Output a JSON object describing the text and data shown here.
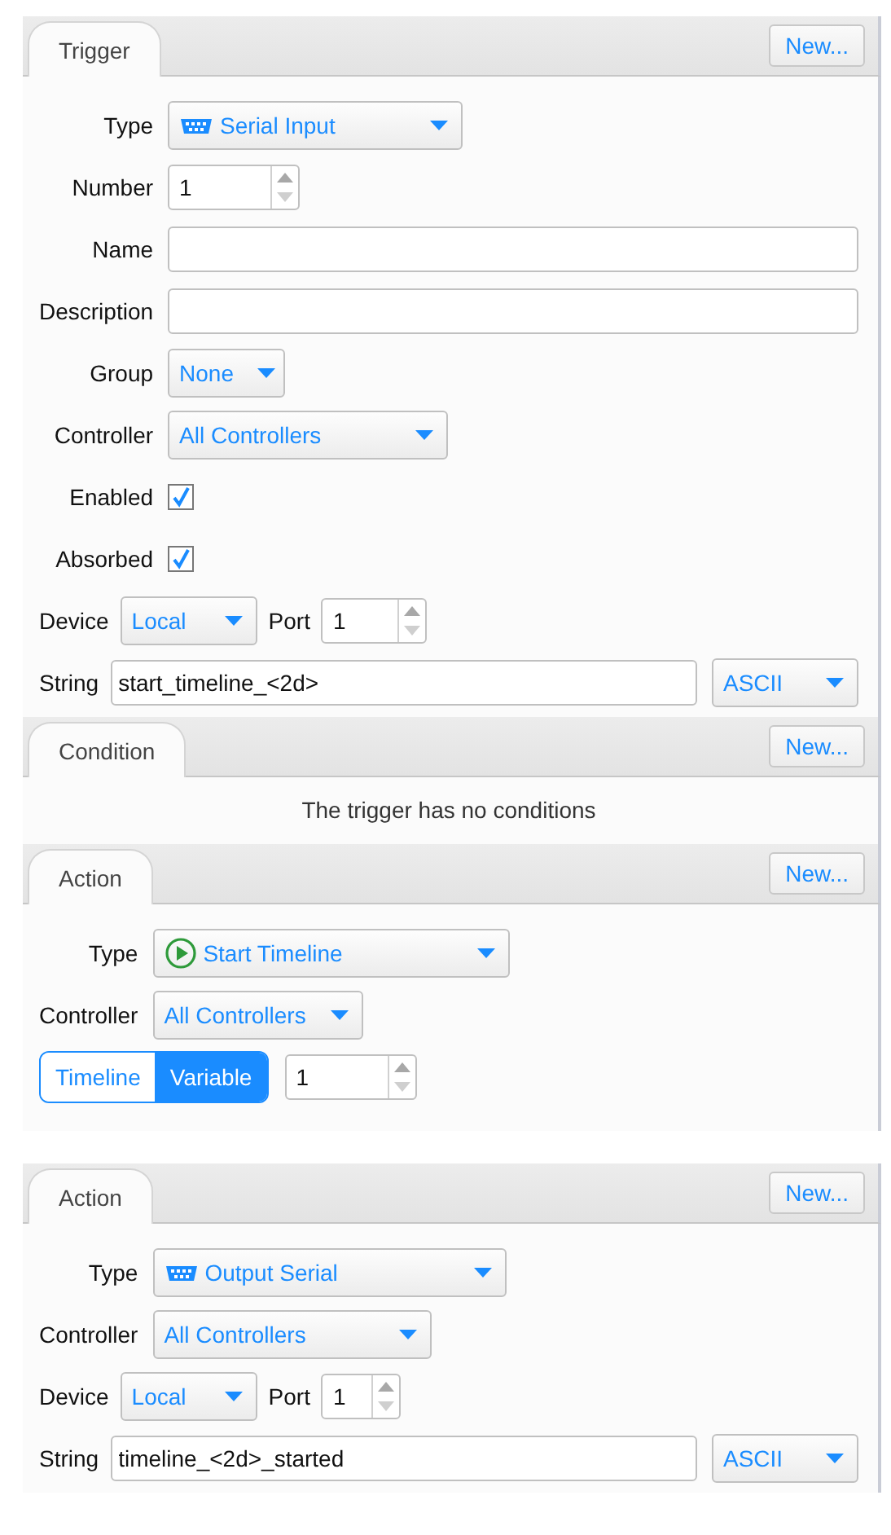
{
  "sections": [
    {
      "tab": "Trigger",
      "new_button": "New...",
      "rows": [
        {
          "kind": "dropdown",
          "label": "Type",
          "value": "Serial Input"
        },
        {
          "kind": "spinner",
          "label": "Number",
          "value": "1"
        },
        {
          "kind": "text",
          "label": "Name"
        },
        {
          "kind": "text",
          "label": "Description"
        },
        {
          "kind": "dropdown",
          "label": "Group",
          "value": "None"
        },
        {
          "kind": "dropdown",
          "label": "Controller",
          "value": "All Controllers"
        },
        {
          "kind": "checkbox",
          "label": "Enabled",
          "checked": true
        },
        {
          "kind": "checkbox",
          "label": "Absorbed",
          "checked": true
        },
        {
          "kind": "device",
          "label": "Device",
          "value": "Local",
          "port_label": "Port",
          "port": "1"
        },
        {
          "kind": "string",
          "label": "String",
          "value": "start_timeline_<2d>",
          "encoding": "ASCII"
        }
      ]
    },
    {
      "tab": "Condition",
      "new_button": "New...",
      "rows": [
        {
          "kind": "message",
          "text": "The trigger has no conditions"
        }
      ]
    },
    {
      "tab": "Action",
      "new_button": "New...",
      "rows": [
        {
          "kind": "dropdown",
          "label": "Type",
          "value": "Start Timeline"
        },
        {
          "kind": "dropdown",
          "label": "Controller",
          "value": "All Controllers"
        },
        {
          "kind": "toggle",
          "options": [
            {
              "label": "Timeline",
              "selected": false
            },
            {
              "label": "Variable",
              "selected": true
            }
          ],
          "value": "1"
        }
      ]
    },
    {
      "tab": "Action",
      "new_button": "New...",
      "rows": [
        {
          "kind": "dropdown",
          "label": "Type",
          "value": "Output Serial"
        },
        {
          "kind": "dropdown",
          "label": "Controller",
          "value": "All Controllers"
        },
        {
          "kind": "device",
          "label": "Device",
          "value": "Local",
          "port_label": "Port",
          "port": "1"
        },
        {
          "kind": "string",
          "label": "String",
          "value": "timeline_<2d>_started",
          "encoding": "ASCII"
        }
      ]
    }
  ]
}
